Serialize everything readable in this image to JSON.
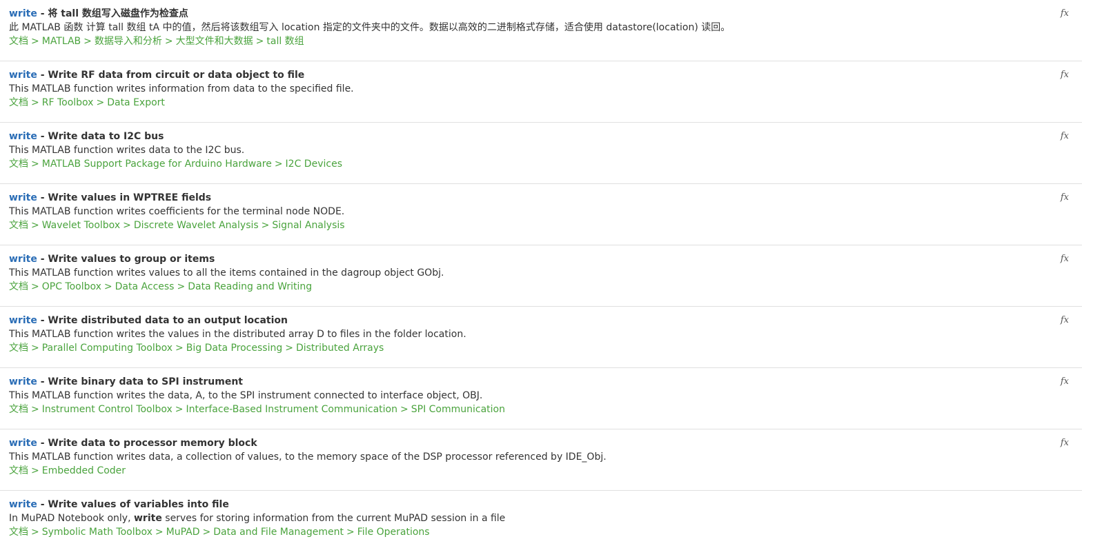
{
  "results": [
    {
      "keyword": "write",
      "title": "将 tall 数组写入磁盘作为检查点",
      "desc_pre": "此 MATLAB 函数 计算 tall 数组 tA 中的值，然后将该数组写入 location 指定的文件夹中的文件。数据以高效的二进制格式存储，适合使用 datastore(location) 读回。",
      "desc_bold": "",
      "desc_post": "",
      "breadcrumb": [
        "文档",
        "MATLAB",
        "数据导入和分析",
        "大型文件和大数据",
        "tall 数组"
      ],
      "icon": "fx"
    },
    {
      "keyword": "write",
      "title": "Write RF data from circuit or data object to file",
      "desc_pre": "This MATLAB function writes information from data to the specified file.",
      "desc_bold": "",
      "desc_post": "",
      "breadcrumb": [
        "文档",
        "RF Toolbox",
        "Data Export"
      ],
      "icon": "fx"
    },
    {
      "keyword": "write",
      "title": "Write data to I2C bus",
      "desc_pre": "This MATLAB function writes data to the I2C bus.",
      "desc_bold": "",
      "desc_post": "",
      "breadcrumb": [
        "文档",
        "MATLAB Support Package for Arduino Hardware",
        "I2C Devices"
      ],
      "icon": "fx"
    },
    {
      "keyword": "write",
      "title": "Write values in WPTREE fields",
      "desc_pre": "This MATLAB function writes coefficients for the terminal node NODE.",
      "desc_bold": "",
      "desc_post": "",
      "breadcrumb": [
        "文档",
        "Wavelet Toolbox",
        "Discrete Wavelet Analysis",
        "Signal Analysis"
      ],
      "icon": "fx"
    },
    {
      "keyword": "write",
      "title": "Write values to group or items",
      "desc_pre": "This MATLAB function writes values to all the items contained in the dagroup object GObj.",
      "desc_bold": "",
      "desc_post": "",
      "breadcrumb": [
        "文档",
        "OPC Toolbox",
        "Data Access",
        "Data Reading and Writing"
      ],
      "icon": "fx"
    },
    {
      "keyword": "write",
      "title": "Write distributed data to an output location",
      "desc_pre": "This MATLAB function writes the values in the distributed array D to files in the folder location.",
      "desc_bold": "",
      "desc_post": "",
      "breadcrumb": [
        "文档",
        "Parallel Computing Toolbox",
        "Big Data Processing",
        "Distributed Arrays"
      ],
      "icon": "fx"
    },
    {
      "keyword": "write",
      "title": "Write binary data to SPI instrument",
      "desc_pre": "This MATLAB function writes the data, A, to the SPI instrument connected to interface object, OBJ.",
      "desc_bold": "",
      "desc_post": "",
      "breadcrumb": [
        "文档",
        "Instrument Control Toolbox",
        "Interface-Based Instrument Communication",
        "SPI Communication"
      ],
      "icon": "fx"
    },
    {
      "keyword": "write",
      "title": "Write data to processor memory block",
      "desc_pre": "This MATLAB function writes data, a collection of values, to the memory space of the DSP processor referenced by IDE_Obj.",
      "desc_bold": "",
      "desc_post": "",
      "breadcrumb": [
        "文档",
        "Embedded Coder"
      ],
      "icon": "fx"
    },
    {
      "keyword": "write",
      "title": "Write values of variables into file",
      "desc_pre": "In MuPAD Notebook only, ",
      "desc_bold": "write",
      "desc_post": " serves for storing information from the current MuPAD session in a file",
      "breadcrumb": [
        "文档",
        "Symbolic Math Toolbox",
        "MuPAD",
        "Data and File Management",
        "File Operations"
      ],
      "icon": ""
    }
  ],
  "separators": {
    "title_dash": " - ",
    "breadcrumb": ">"
  }
}
